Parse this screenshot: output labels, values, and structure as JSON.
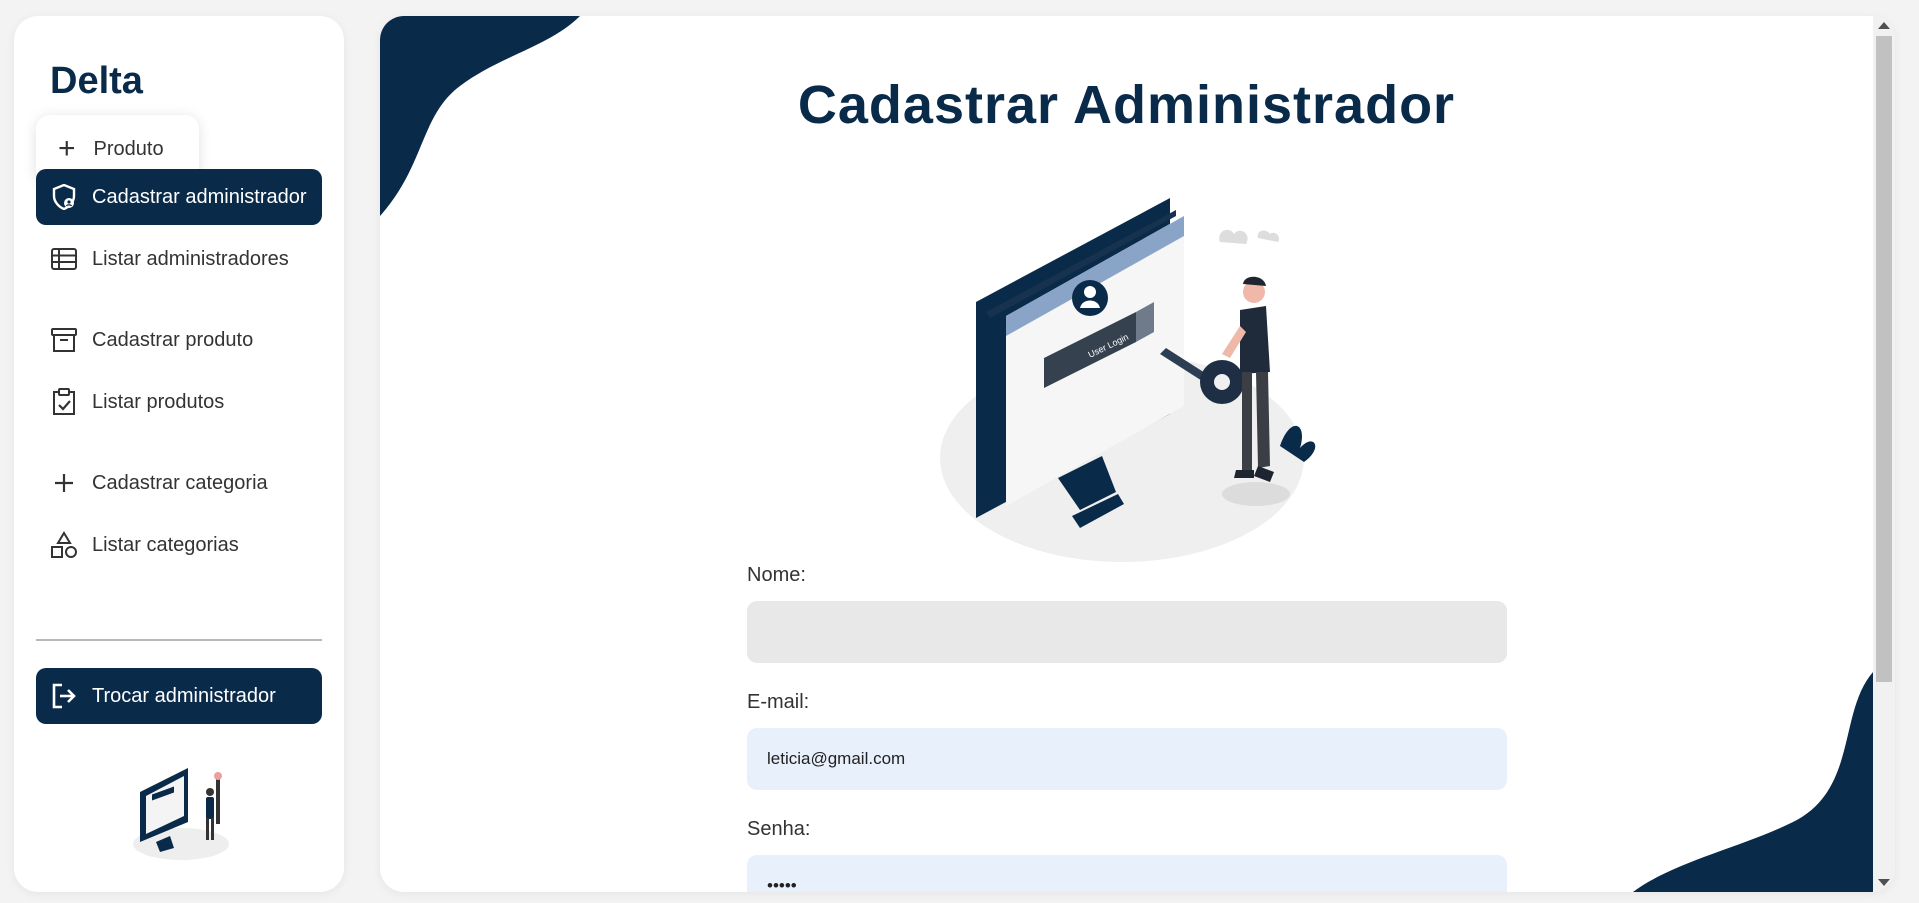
{
  "sidebar": {
    "brand": "Delta",
    "new_button": {
      "icon": "plus-icon",
      "label": "Produto"
    },
    "items": [
      {
        "icon": "shield-user-icon",
        "label": "Cadastrar administrador",
        "active": true
      },
      {
        "icon": "table-list-icon",
        "label": "Listar administradores",
        "active": false
      },
      {
        "icon": "archive-box-icon",
        "label": "Cadastrar produto",
        "active": false
      },
      {
        "icon": "clipboard-check-icon",
        "label": "Listar produtos",
        "active": false
      },
      {
        "icon": "plus-icon",
        "label": "Cadastrar categoria",
        "active": false
      },
      {
        "icon": "shapes-icon",
        "label": "Listar categorias",
        "active": false
      }
    ],
    "logout": {
      "icon": "logout-icon",
      "label": "Trocar administrador"
    }
  },
  "main": {
    "title": "Cadastrar Administrador",
    "hero_screen_text": "User Login",
    "form": {
      "name_label": "Nome:",
      "name_value": "",
      "email_label": "E-mail:",
      "email_value": "leticia@gmail.com",
      "password_label": "Senha:",
      "password_value": "•••••"
    }
  },
  "colors": {
    "primary": "#0a2a4a",
    "page_background": "#f3f3f3",
    "input_empty": "#e8e8e8",
    "input_filled": "#e8f0fc"
  }
}
